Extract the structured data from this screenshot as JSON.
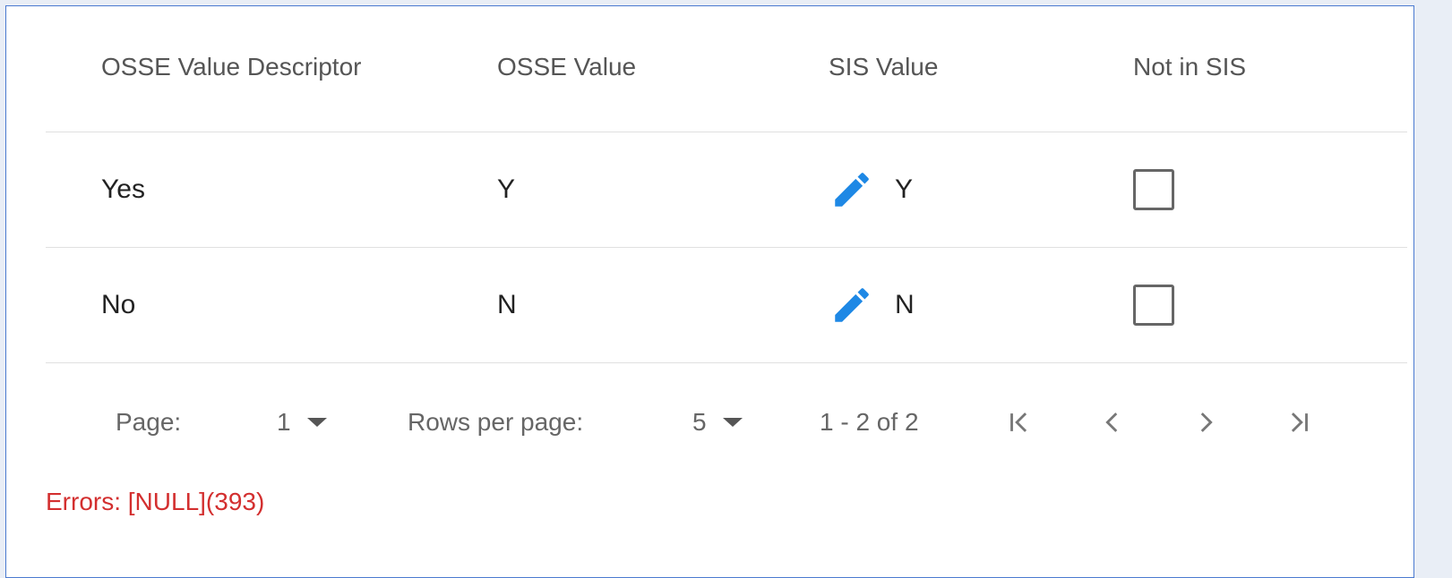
{
  "table": {
    "headers": [
      "OSSE Value Descriptor",
      "OSSE Value",
      "SIS Value",
      "Not in SIS"
    ],
    "rows": [
      {
        "descriptor": "Yes",
        "osse_value": "Y",
        "sis_value": "Y",
        "not_in_sis": false
      },
      {
        "descriptor": "No",
        "osse_value": "N",
        "sis_value": "N",
        "not_in_sis": false
      }
    ]
  },
  "pagination": {
    "page_label": "Page:",
    "page_value": "1",
    "rows_per_page_label": "Rows per page:",
    "rows_per_page_value": "5",
    "range_text": "1 - 2 of 2"
  },
  "errors_text": "Errors: [NULL](393)",
  "colors": {
    "accent": "#1e88e5",
    "error": "#d32f2f",
    "border": "#4a7ad0"
  },
  "icons": {
    "edit": "pencil-icon",
    "first": "first-page-icon",
    "prev": "chevron-left-icon",
    "next": "chevron-right-icon",
    "last": "last-page-icon"
  }
}
